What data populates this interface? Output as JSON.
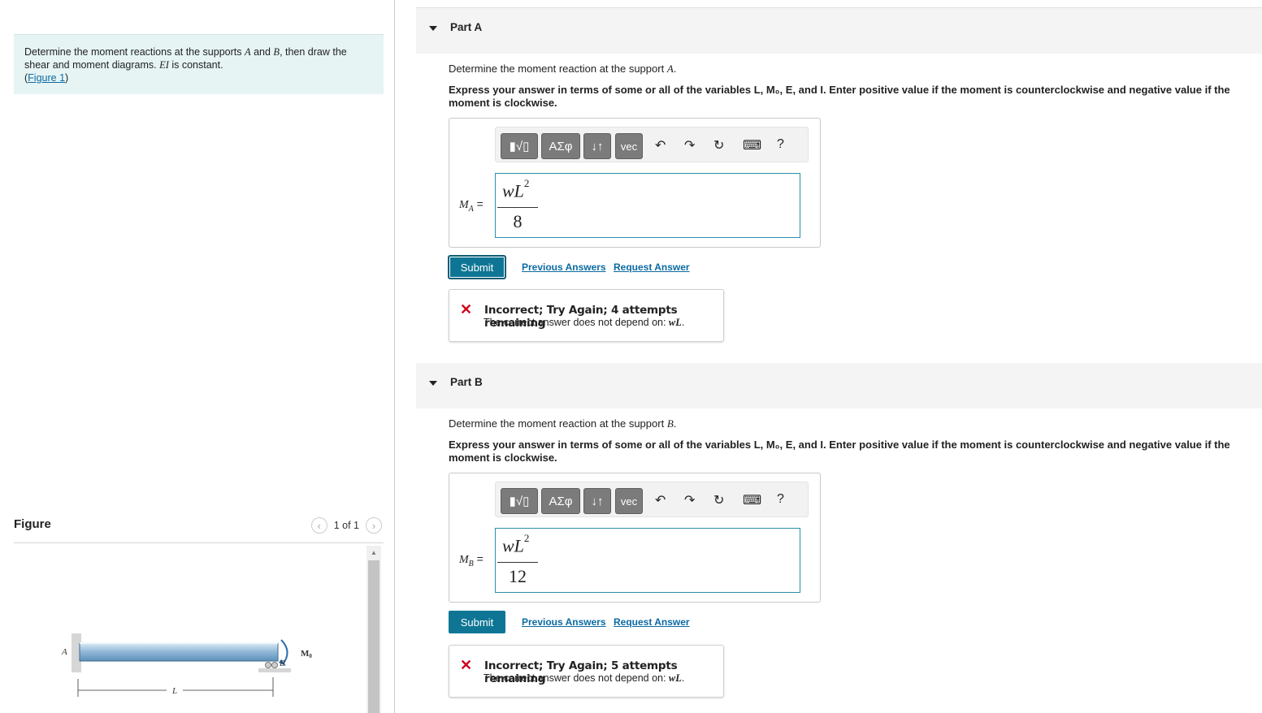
{
  "problem": {
    "text_before": "Determine the moment reactions at the supports ",
    "var_a": "A",
    "and": " and ",
    "var_b": "B",
    "text_mid": ", then draw the shear and moment diagrams. ",
    "var_ei": "EI",
    "text_end": " is constant.",
    "figure_link": "Figure 1"
  },
  "figure": {
    "title": "Figure",
    "pager": "1 of 1",
    "labels": {
      "a": "A",
      "b": "B",
      "m0": "M",
      "m0_sub": "0",
      "l": "L"
    }
  },
  "parts": [
    {
      "title": "Part A",
      "question_text": "Determine the moment reaction at the support ",
      "question_var": "A",
      "instruction": "Express your answer in terms of some or all of the variables L, M₀, E, and I. Enter positive value if the moment is counterclockwise and negative value if the moment is clockwise.",
      "lhs": "M",
      "lhs_sub": "A",
      "answer_num": "wL",
      "answer_exp": "2",
      "answer_den": "8",
      "submit": "Submit",
      "previous_answers": "Previous Answers",
      "request_answer": "Request Answer",
      "feedback_title": "Incorrect; Try Again; 4 attempts remaining",
      "feedback_text": "The correct answer does not depend on: ",
      "feedback_var": "wL"
    },
    {
      "title": "Part B",
      "question_text": "Determine the moment reaction at the support ",
      "question_var": "B",
      "instruction": "Express your answer in terms of some or all of the variables L, M₀, E, and I. Enter positive value if the moment is counterclockwise and negative value if the moment is clockwise.",
      "lhs": "M",
      "lhs_sub": "B",
      "answer_num": "wL",
      "answer_exp": "2",
      "answer_den": "12",
      "submit": "Submit",
      "previous_answers": "Previous Answers",
      "request_answer": "Request Answer",
      "feedback_title": "Incorrect; Try Again; 5 attempts remaining",
      "feedback_text": "The correct answer does not depend on: ",
      "feedback_var": "wL"
    }
  ],
  "toolbar": {
    "templates": "▮√▯",
    "greek": "ΑΣφ",
    "arrows": "↓↑",
    "vec": "vec",
    "undo": "↶",
    "redo": "↷",
    "reset": "↻",
    "keyboard": "⌨",
    "help": "?"
  },
  "colors": {
    "accent": "#0e7694",
    "problem_bg": "#e6f4f4",
    "error": "#d0021b",
    "link": "#0b6aa2"
  }
}
